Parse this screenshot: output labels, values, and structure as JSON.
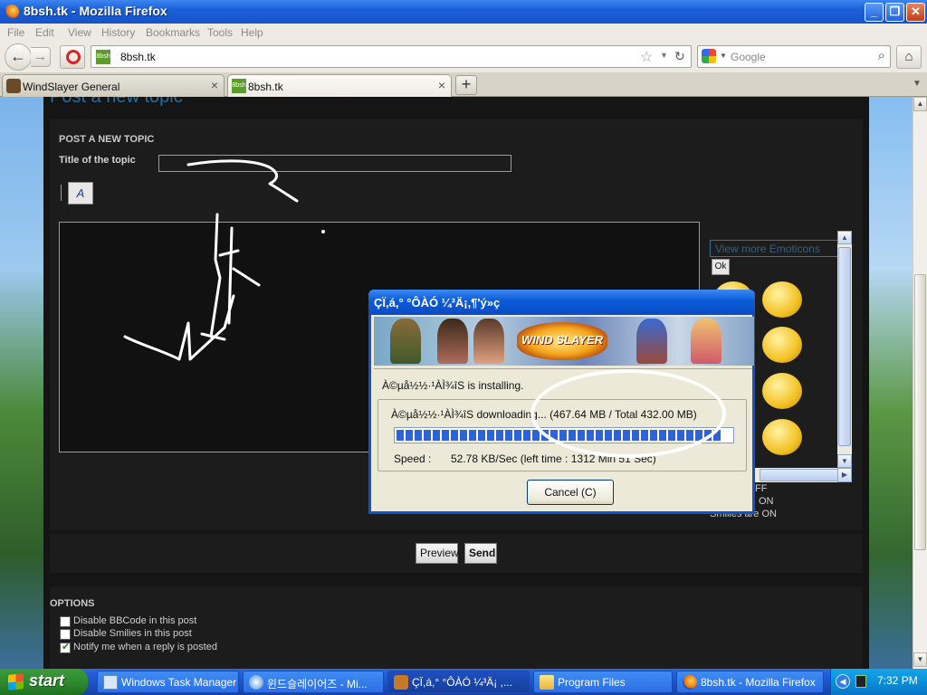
{
  "window": {
    "title": "8bsh.tk - Mozilla Firefox"
  },
  "menu": [
    "File",
    "Edit",
    "View",
    "History",
    "Bookmarks",
    "Tools",
    "Help"
  ],
  "navbar": {
    "url": "8bsh.tk",
    "site_icon": "8bsh-site-icon",
    "search_placeholder": "Google"
  },
  "tabs": [
    {
      "label": "WindSlayer General",
      "active": false
    },
    {
      "label": "8bsh.tk",
      "active": true
    }
  ],
  "page": {
    "headline": "Post a new topic",
    "section": "POST A NEW TOPIC",
    "title_label": "Title of the topic",
    "title_value": "",
    "font_button": "A",
    "emoticons": {
      "link": "View more Emoticons",
      "ok": "Ok",
      "count": 8
    },
    "status_lines": [
      "FF",
      "ON",
      "Smilies are ON"
    ],
    "buttons": {
      "preview": "Preview",
      "send": "Send"
    },
    "options": {
      "heading": "OPTIONS",
      "items": [
        {
          "label": "Disable BBCode in this post",
          "checked": false
        },
        {
          "label": "Disable Smilies in this post",
          "checked": false
        },
        {
          "label": "Notify me when a reply is posted",
          "checked": true
        }
      ]
    }
  },
  "dialog": {
    "title": "ÇÏ,á,° °ÔÀÓ ¼³Ä¡,¶'ý»ç",
    "banner_logo": "WIND SLAYER",
    "status": "À©µå½½·¹ÀÌ¾îS is installing.",
    "download_text": "À©µå½½·¹ÀÌ¾îS downloading... (467.64 MB / Total 432.00 MB)",
    "progress": 0.97,
    "speed_label": "Speed :",
    "speed_value": "52.78 KB/Sec (left time : 1312 Min 51 Sec)",
    "cancel_label": "Cancel (C)"
  },
  "taskbar": {
    "start": "start",
    "items": [
      {
        "label": "Windows Task Manager",
        "active": false
      },
      {
        "label": "윈드슬레이어즈 - Mi...",
        "active": false
      },
      {
        "label": "ÇÏ,á,° °ÔÀÓ ¼³Ä¡ ,...",
        "active": true
      },
      {
        "label": "Program Files",
        "active": false
      },
      {
        "label": "8bsh.tk - Mozilla Firefox",
        "active": false
      }
    ],
    "clock": "7:32 PM"
  },
  "colors": {
    "forum_bg": "#151515",
    "link": "#2a6a9e",
    "xp_blue": "#0a54d6",
    "progress": "#2e63d5"
  }
}
